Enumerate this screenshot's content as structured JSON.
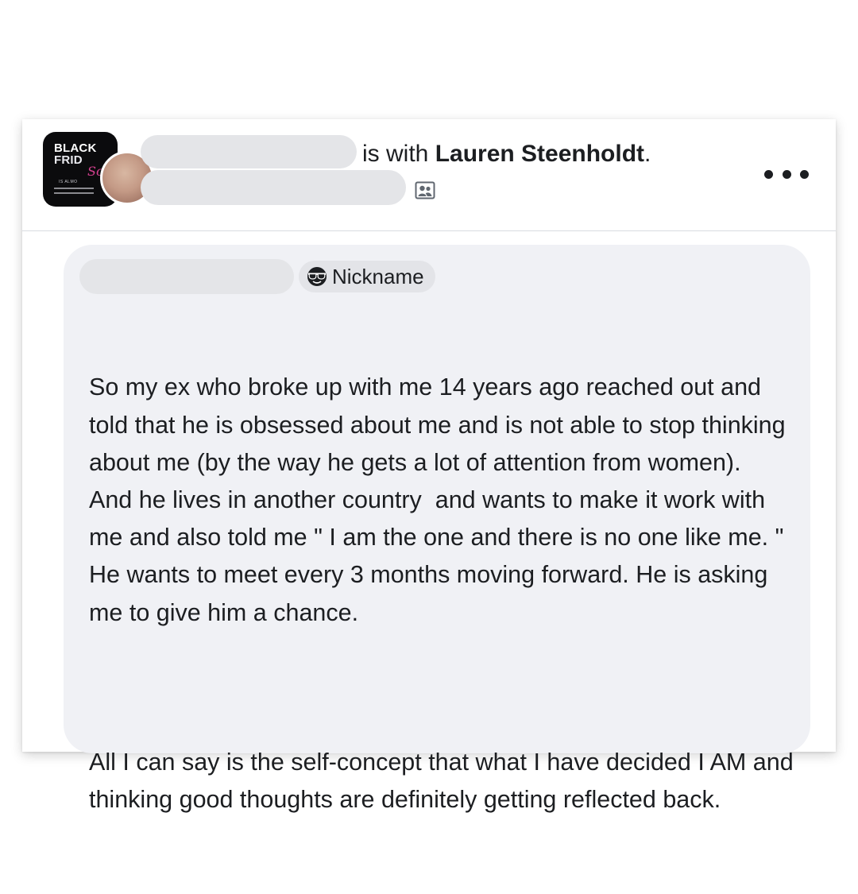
{
  "post": {
    "group_avatar": {
      "line1": "BLACK",
      "line2": "FRID",
      "script": "So",
      "small": "IS ALMO"
    },
    "with_prefix": "is with ",
    "tagged_name": "Lauren Steenholdt",
    "with_suffix": ".",
    "audience_icon": "members-icon",
    "more_icon": "more-options-icon"
  },
  "comment": {
    "badge_icon": "sunglasses-face-icon",
    "badge_label": "Nickname",
    "paragraphs": [
      "So my ex who broke up with me 14 years ago reached out and told that he is obsessed about me and is not able to stop thinking about me (by the way he gets a lot of attention from women).  And he lives in another country  and wants to make it work with me and also told me \" I am the one and there is no one like me. \" He wants to meet every 3 months moving forward. He is asking me to give him a chance.",
      "All I can say is the self-concept that what I have decided I AM and thinking good thoughts are definitely getting reflected back."
    ]
  },
  "colors": {
    "text": "#1c1e21",
    "bubble": "#f0f1f5",
    "redaction": "#e4e5e8",
    "accent_pink": "#d4408f"
  }
}
